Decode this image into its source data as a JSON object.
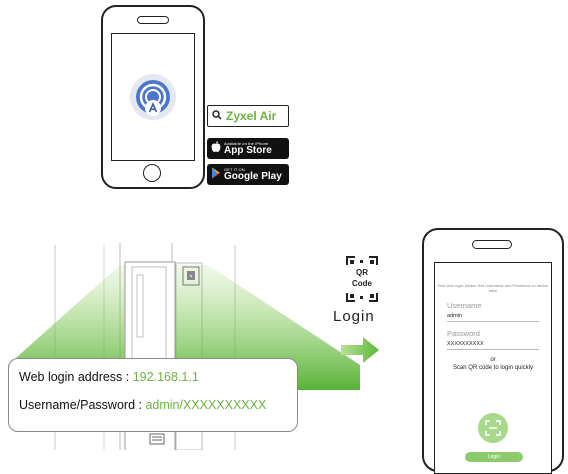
{
  "download": {
    "search_label": "Zyxel Air",
    "app_store": {
      "small": "Available on the iPhone",
      "big": "App Store"
    },
    "google_play": {
      "small": "GET IT ON",
      "big": "Google Play"
    }
  },
  "device_label": {
    "address_label": "Web login address : ",
    "address_value": "192.168.1.1",
    "credentials_label": "Username/Password : ",
    "credentials_value": "admin/XXXXXXXXXX"
  },
  "step": {
    "qr_line1": "QR",
    "qr_line2": "Code",
    "login_word": "Login"
  },
  "login_screen": {
    "hint": "First time login please find Username and Password on device label",
    "username_label": "Username",
    "username_value": "admin",
    "password_label": "Password",
    "password_value": "XXXXXXXXXX",
    "or_text": "or",
    "scan_text": "Scan QR code to login quickly",
    "login_button": "Login"
  },
  "colors": {
    "brand_green": "#6cb33f",
    "light_green": "#a6d98a",
    "app_blue": "#4b76c9"
  }
}
